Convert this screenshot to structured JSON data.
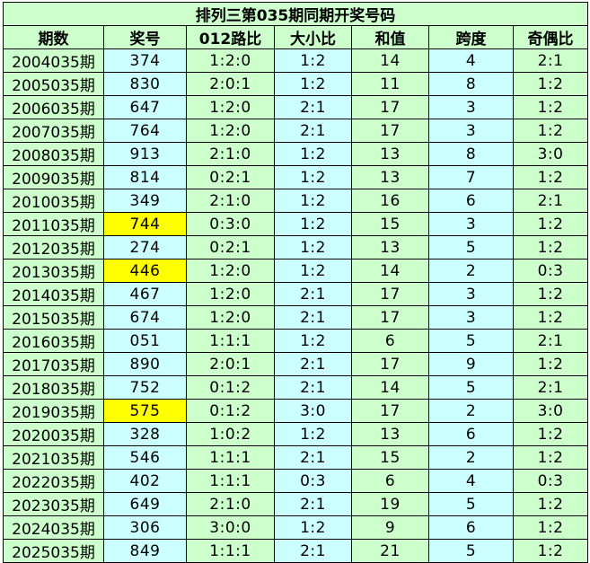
{
  "title": "排列三第035期同期开奖号码",
  "columns": [
    "期数",
    "奖号",
    "012路比",
    "大小比",
    "和值",
    "跨度",
    "奇偶比"
  ],
  "colors": {
    "header_bg": "#ccffcc",
    "cell_green": "#ccffcc",
    "cell_cyan": "#ccffff",
    "highlight": "#ffff00",
    "border": "#000000"
  },
  "rows": [
    {
      "period": "2004035期",
      "number": "374",
      "road012": "1:2:0",
      "big_small": "1:2",
      "sum": "14",
      "span": "4",
      "odd_even": "2:1",
      "highlight": false
    },
    {
      "period": "2005035期",
      "number": "830",
      "road012": "2:0:1",
      "big_small": "1:2",
      "sum": "11",
      "span": "8",
      "odd_even": "1:2",
      "highlight": false
    },
    {
      "period": "2006035期",
      "number": "647",
      "road012": "1:2:0",
      "big_small": "2:1",
      "sum": "17",
      "span": "3",
      "odd_even": "1:2",
      "highlight": false
    },
    {
      "period": "2007035期",
      "number": "764",
      "road012": "1:2:0",
      "big_small": "2:1",
      "sum": "17",
      "span": "3",
      "odd_even": "1:2",
      "highlight": false
    },
    {
      "period": "2008035期",
      "number": "913",
      "road012": "2:1:0",
      "big_small": "1:2",
      "sum": "13",
      "span": "8",
      "odd_even": "3:0",
      "highlight": false
    },
    {
      "period": "2009035期",
      "number": "814",
      "road012": "0:2:1",
      "big_small": "1:2",
      "sum": "13",
      "span": "7",
      "odd_even": "1:2",
      "highlight": false
    },
    {
      "period": "2010035期",
      "number": "349",
      "road012": "2:1:0",
      "big_small": "1:2",
      "sum": "16",
      "span": "6",
      "odd_even": "2:1",
      "highlight": false
    },
    {
      "period": "2011035期",
      "number": "744",
      "road012": "0:3:0",
      "big_small": "1:2",
      "sum": "15",
      "span": "3",
      "odd_even": "1:2",
      "highlight": true
    },
    {
      "period": "2012035期",
      "number": "274",
      "road012": "0:2:1",
      "big_small": "1:2",
      "sum": "13",
      "span": "5",
      "odd_even": "1:2",
      "highlight": false
    },
    {
      "period": "2013035期",
      "number": "446",
      "road012": "1:2:0",
      "big_small": "1:2",
      "sum": "14",
      "span": "2",
      "odd_even": "0:3",
      "highlight": true
    },
    {
      "period": "2014035期",
      "number": "467",
      "road012": "1:2:0",
      "big_small": "2:1",
      "sum": "17",
      "span": "3",
      "odd_even": "1:2",
      "highlight": false
    },
    {
      "period": "2015035期",
      "number": "674",
      "road012": "1:2:0",
      "big_small": "2:1",
      "sum": "17",
      "span": "3",
      "odd_even": "1:2",
      "highlight": false
    },
    {
      "period": "2016035期",
      "number": "051",
      "road012": "1:1:1",
      "big_small": "1:2",
      "sum": "6",
      "span": "5",
      "odd_even": "2:1",
      "highlight": false
    },
    {
      "period": "2017035期",
      "number": "890",
      "road012": "2:0:1",
      "big_small": "2:1",
      "sum": "17",
      "span": "9",
      "odd_even": "1:2",
      "highlight": false
    },
    {
      "period": "2018035期",
      "number": "752",
      "road012": "0:1:2",
      "big_small": "2:1",
      "sum": "14",
      "span": "5",
      "odd_even": "2:1",
      "highlight": false
    },
    {
      "period": "2019035期",
      "number": "575",
      "road012": "0:1:2",
      "big_small": "3:0",
      "sum": "17",
      "span": "2",
      "odd_even": "3:0",
      "highlight": true
    },
    {
      "period": "2020035期",
      "number": "328",
      "road012": "1:0:2",
      "big_small": "1:2",
      "sum": "13",
      "span": "6",
      "odd_even": "1:2",
      "highlight": false
    },
    {
      "period": "2021035期",
      "number": "546",
      "road012": "1:1:1",
      "big_small": "2:1",
      "sum": "15",
      "span": "2",
      "odd_even": "1:2",
      "highlight": false
    },
    {
      "period": "2022035期",
      "number": "402",
      "road012": "1:1:1",
      "big_small": "0:3",
      "sum": "6",
      "span": "4",
      "odd_even": "0:3",
      "highlight": false
    },
    {
      "period": "2023035期",
      "number": "649",
      "road012": "2:1:0",
      "big_small": "2:1",
      "sum": "19",
      "span": "5",
      "odd_even": "1:2",
      "highlight": false
    },
    {
      "period": "2024035期",
      "number": "306",
      "road012": "3:0:0",
      "big_small": "1:2",
      "sum": "9",
      "span": "6",
      "odd_even": "1:2",
      "highlight": false
    },
    {
      "period": "2025035期",
      "number": "849",
      "road012": "1:1:1",
      "big_small": "2:1",
      "sum": "21",
      "span": "5",
      "odd_even": "1:2",
      "highlight": false
    }
  ]
}
